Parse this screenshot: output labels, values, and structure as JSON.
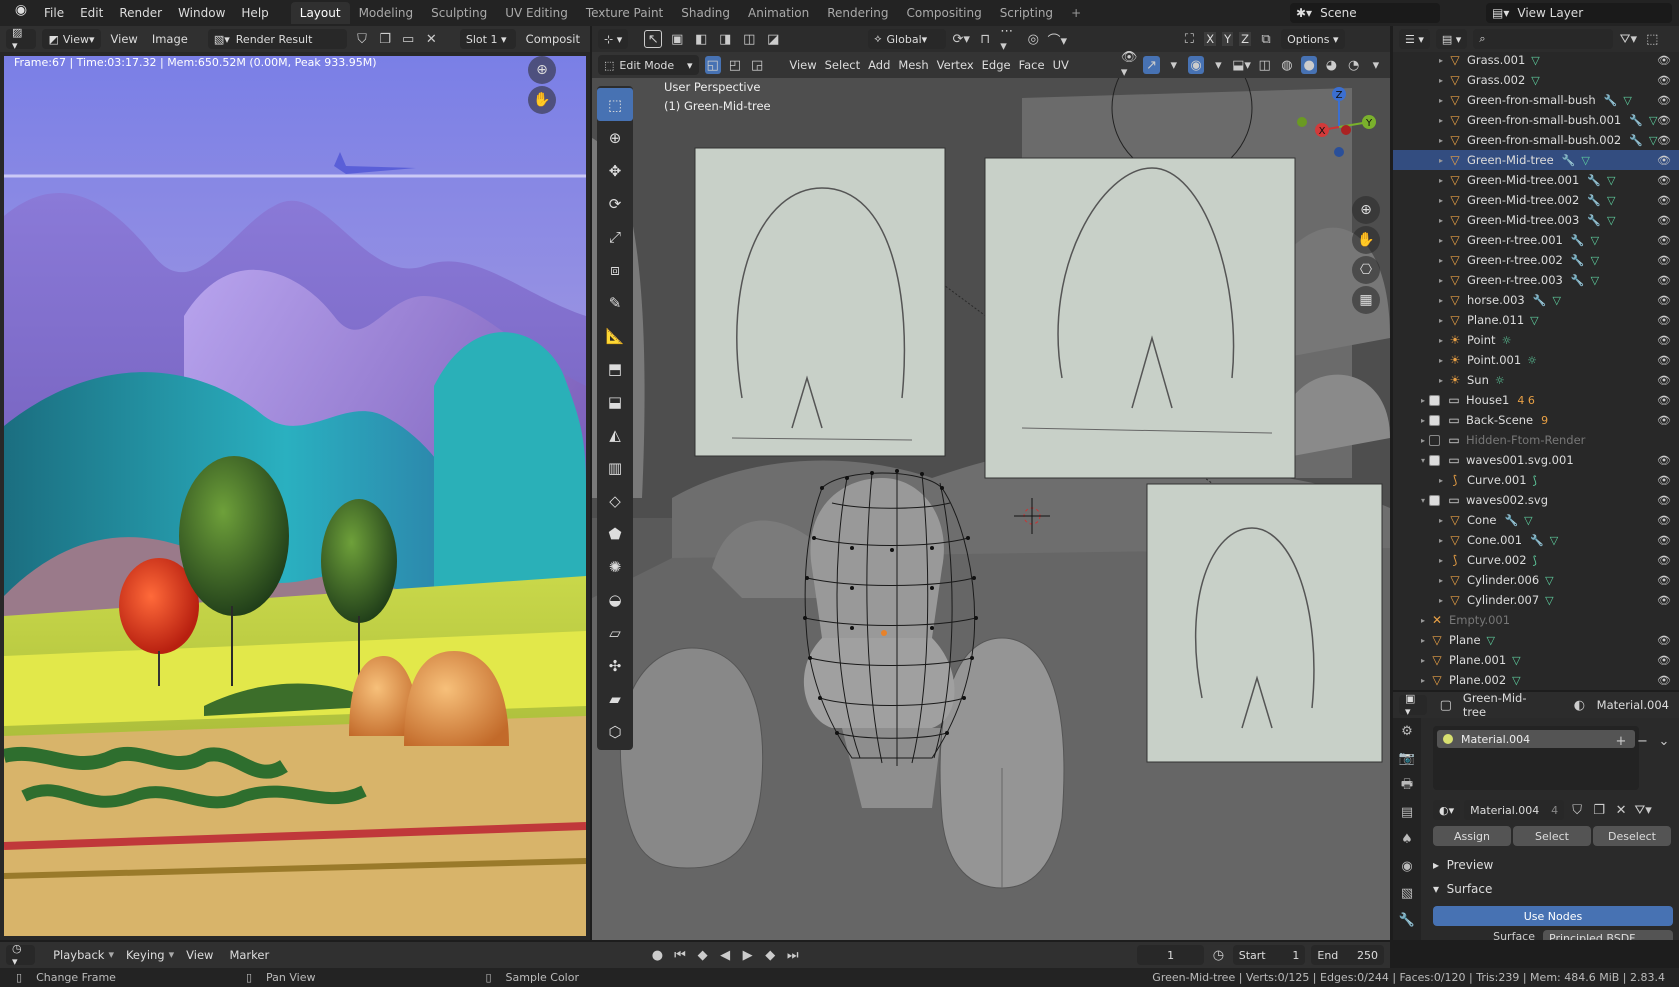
{
  "topbar": {
    "menu": [
      "File",
      "Edit",
      "Render",
      "Window",
      "Help"
    ],
    "workspaces": [
      "Layout",
      "Modeling",
      "Sculpting",
      "UV Editing",
      "Texture Paint",
      "Shading",
      "Animation",
      "Rendering",
      "Compositing",
      "Scripting"
    ],
    "active_workspace": "Layout",
    "scene": "Scene",
    "view_layer": "View Layer"
  },
  "image_editor": {
    "menu": [
      "View",
      "Image"
    ],
    "view_label": "View",
    "image_name": "Render Result",
    "slot": "Slot 1",
    "composite": "Composit",
    "hud": "Frame:67 | Time:03:17.32 | Mem:650.52M (0.00M, Peak 933.95M)"
  },
  "viewport": {
    "orientation": "Global",
    "options": "Options",
    "mode": "Edit Mode",
    "menu": [
      "View",
      "Select",
      "Add",
      "Mesh",
      "Vertex",
      "Edge",
      "Face",
      "UV"
    ],
    "perspective": "User Perspective",
    "active_object": "(1) Green-Mid-tree",
    "axes": {
      "x": "X",
      "y": "Y",
      "z": "Z"
    },
    "mirror": [
      "X",
      "Y",
      "Z"
    ]
  },
  "outliner": {
    "rows": [
      {
        "name": "Grass.001",
        "icon": "mesh",
        "mod": false,
        "data": true,
        "depth": 2
      },
      {
        "name": "Grass.002",
        "icon": "mesh",
        "mod": false,
        "data": true,
        "depth": 2
      },
      {
        "name": "Green-fron-small-bush",
        "icon": "mesh",
        "mod": true,
        "data": true,
        "depth": 2
      },
      {
        "name": "Green-fron-small-bush.001",
        "icon": "mesh",
        "mod": true,
        "data": true,
        "depth": 2
      },
      {
        "name": "Green-fron-small-bush.002",
        "icon": "mesh",
        "mod": true,
        "data": true,
        "depth": 2
      },
      {
        "name": "Green-Mid-tree",
        "icon": "mesh",
        "mod": true,
        "data": true,
        "depth": 2,
        "selected": true
      },
      {
        "name": "Green-Mid-tree.001",
        "icon": "mesh",
        "mod": true,
        "data": true,
        "depth": 2
      },
      {
        "name": "Green-Mid-tree.002",
        "icon": "mesh",
        "mod": true,
        "data": true,
        "depth": 2
      },
      {
        "name": "Green-Mid-tree.003",
        "icon": "mesh",
        "mod": true,
        "data": true,
        "depth": 2
      },
      {
        "name": "Green-r-tree.001",
        "icon": "mesh",
        "mod": true,
        "data": true,
        "depth": 2
      },
      {
        "name": "Green-r-tree.002",
        "icon": "mesh",
        "mod": true,
        "data": true,
        "depth": 2
      },
      {
        "name": "Green-r-tree.003",
        "icon": "mesh",
        "mod": true,
        "data": true,
        "depth": 2
      },
      {
        "name": "horse.003",
        "icon": "mesh",
        "mod": true,
        "data": true,
        "depth": 2
      },
      {
        "name": "Plane.011",
        "icon": "mesh",
        "mod": false,
        "data": true,
        "depth": 2
      },
      {
        "name": "Point",
        "icon": "light",
        "mod": false,
        "data": true,
        "depth": 2
      },
      {
        "name": "Point.001",
        "icon": "light",
        "mod": false,
        "data": true,
        "depth": 2
      },
      {
        "name": "Sun",
        "icon": "light",
        "mod": false,
        "data": true,
        "depth": 2
      },
      {
        "name": "House1",
        "icon": "collection",
        "checkbox": true,
        "depth": 1,
        "badge": "4  6"
      },
      {
        "name": "Back-Scene",
        "icon": "collection",
        "checkbox": true,
        "depth": 1,
        "badge": "9"
      },
      {
        "name": "Hidden-Ftom-Render",
        "icon": "collection",
        "checkbox": true,
        "unchecked": true,
        "dim": true,
        "depth": 1
      },
      {
        "name": "waves001.svg.001",
        "icon": "collection",
        "checkbox": true,
        "depth": 1,
        "open": true
      },
      {
        "name": "Curve.001",
        "icon": "curve",
        "data": true,
        "depth": 2
      },
      {
        "name": "waves002.svg",
        "icon": "collection",
        "checkbox": true,
        "depth": 1,
        "open": true
      },
      {
        "name": "Cone",
        "icon": "mesh",
        "mod": true,
        "data": true,
        "depth": 2
      },
      {
        "name": "Cone.001",
        "icon": "mesh",
        "mod": true,
        "data": true,
        "depth": 2
      },
      {
        "name": "Curve.002",
        "icon": "curve",
        "data": true,
        "depth": 2
      },
      {
        "name": "Cylinder.006",
        "icon": "mesh",
        "data": true,
        "depth": 2
      },
      {
        "name": "Cylinder.007",
        "icon": "mesh",
        "data": true,
        "depth": 2
      },
      {
        "name": "Empty.001",
        "icon": "empty",
        "dim": true,
        "depth": 1
      },
      {
        "name": "Plane",
        "icon": "mesh",
        "data": true,
        "depth": 1
      },
      {
        "name": "Plane.001",
        "icon": "mesh",
        "data": true,
        "depth": 1
      },
      {
        "name": "Plane.002",
        "icon": "mesh",
        "data": true,
        "depth": 1
      }
    ]
  },
  "properties": {
    "object": "Green-Mid-tree",
    "material_header": "Material.004",
    "slot_name": "Material.004",
    "material_field": "Material.004",
    "users": "4",
    "assign": "Assign",
    "select": "Select",
    "deselect": "Deselect",
    "preview": "Preview",
    "surface": "Surface",
    "use_nodes": "Use Nodes",
    "surface_label": "Surface",
    "surface_value": "Principled BSDF"
  },
  "timeline": {
    "menu": [
      "Playback",
      "Keying",
      "View",
      "Marker"
    ],
    "current_frame": "1",
    "start_label": "Start",
    "start": "1",
    "end_label": "End",
    "end": "250"
  },
  "statusbar": {
    "left": [
      "Change Frame",
      "Pan View",
      "Sample Color"
    ],
    "right": "Green-Mid-tree | Verts:0/125 | Edges:0/244 | Faces:0/120 | Tris:239 | Mem: 484.6 MiB | 2.83.4"
  }
}
